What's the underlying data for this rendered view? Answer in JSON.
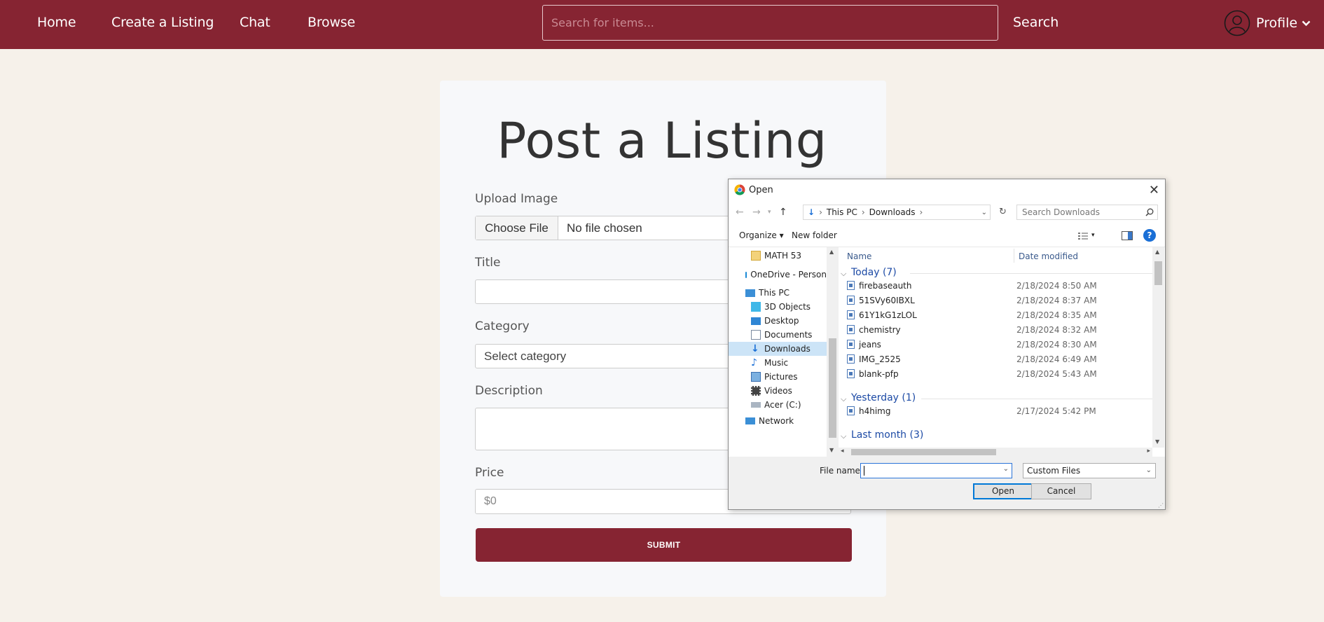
{
  "nav": {
    "links": [
      "Home",
      "Create a Listing",
      "Chat",
      "Browse"
    ],
    "search_placeholder": "Search for items...",
    "search_label": "Search",
    "profile_label": "Profile"
  },
  "form": {
    "title": "Post a Listing",
    "upload_label": "Upload Image",
    "choose_file": "Choose File",
    "no_file": "No file chosen",
    "title_label": "Title",
    "category_label": "Category",
    "category_value": "Select category",
    "description_label": "Description",
    "price_label": "Price",
    "price_placeholder": "$0",
    "submit_label": "SUBMIT"
  },
  "dialog": {
    "title": "Open",
    "breadcrumb": [
      "This PC",
      "Downloads"
    ],
    "search_placeholder": "Search Downloads",
    "organize": "Organize",
    "new_folder": "New folder",
    "tree": [
      "MATH 53",
      "OneDrive - Person",
      "This PC",
      "3D Objects",
      "Desktop",
      "Documents",
      "Downloads",
      "Music",
      "Pictures",
      "Videos",
      "Acer (C:)",
      "Network"
    ],
    "col_name": "Name",
    "col_date": "Date modified",
    "groups": [
      {
        "label": "Today (7)",
        "files": [
          {
            "name": "firebaseauth",
            "date": "2/18/2024 8:50 AM"
          },
          {
            "name": "51SVy60IBXL",
            "date": "2/18/2024 8:37 AM"
          },
          {
            "name": "61Y1kG1zLOL",
            "date": "2/18/2024 8:35 AM"
          },
          {
            "name": "chemistry",
            "date": "2/18/2024 8:32 AM"
          },
          {
            "name": "jeans",
            "date": "2/18/2024 8:30 AM"
          },
          {
            "name": "IMG_2525",
            "date": "2/18/2024 6:49 AM"
          },
          {
            "name": "blank-pfp",
            "date": "2/18/2024 5:43 AM"
          }
        ]
      },
      {
        "label": "Yesterday (1)",
        "files": [
          {
            "name": "h4himg",
            "date": "2/17/2024 5:42 PM"
          }
        ]
      },
      {
        "label": "Last month (3)",
        "files": []
      }
    ],
    "filename_label": "File name:",
    "filetype": "Custom Files",
    "open_button": "Open",
    "cancel_button": "Cancel"
  }
}
